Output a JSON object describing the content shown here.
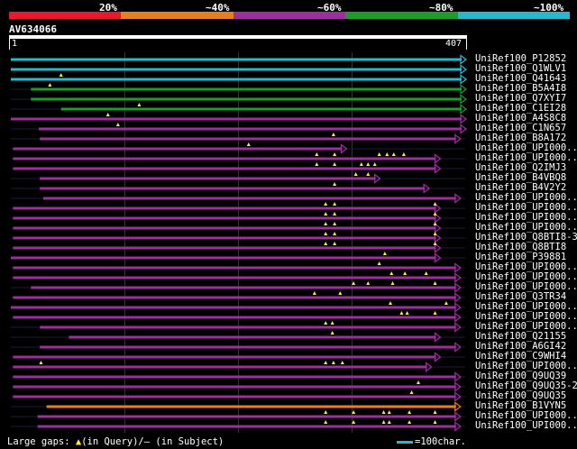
{
  "legend": {
    "labels": [
      "20%",
      "~40%",
      "~60%",
      "~80%",
      "~100%"
    ],
    "colors": [
      "#e8192c",
      "#e67e22",
      "#9b2f9b",
      "#1e9b2a",
      "#2ab7c9"
    ]
  },
  "query": {
    "id": "AV634066",
    "start": "1",
    "end": "407",
    "length": 407
  },
  "hits": [
    {
      "label": "UniRef100_P12852",
      "color": "#2ab7c9",
      "segs": [
        [
          0,
          407
        ]
      ],
      "arrow": true,
      "tris": []
    },
    {
      "label": "UniRef100_Q1WLV1",
      "color": "#2ab7c9",
      "segs": [
        [
          0,
          407
        ]
      ],
      "arrow": true,
      "tris": []
    },
    {
      "label": "UniRef100_Q41643",
      "color": "#2ab7c9",
      "segs": [
        [
          0,
          407
        ]
      ],
      "arrow": true,
      "tris": [
        45
      ]
    },
    {
      "label": "UniRef100_B5A4I8",
      "color": "#1e9b2a",
      "segs": [
        [
          18,
          407
        ]
      ],
      "arrow": true,
      "tris": [
        35
      ]
    },
    {
      "label": "UniRef100_Q7XYI7",
      "color": "#1e9b2a",
      "segs": [
        [
          18,
          407
        ]
      ],
      "arrow": true,
      "tris": []
    },
    {
      "label": "UniRef100_C1EI28",
      "color": "#1e9b2a",
      "segs": [
        [
          45,
          407
        ]
      ],
      "arrow": true,
      "tris": [
        115
      ]
    },
    {
      "label": "UniRef100_A4S8C8",
      "color": "#9b2f9b",
      "segs": [
        [
          0,
          407
        ]
      ],
      "arrow": true,
      "tris": [
        87
      ]
    },
    {
      "label": "UniRef100_C1N657",
      "color": "#9b2f9b",
      "segs": [
        [
          25,
          407
        ]
      ],
      "arrow": true,
      "tris": [
        96
      ]
    },
    {
      "label": "UniRef100_B8A172",
      "color": "#9b2f9b",
      "segs": [
        [
          26,
          402
        ]
      ],
      "arrow": true,
      "tris": [
        289
      ]
    },
    {
      "label": "UniRef100_UPI000..",
      "color": "#9b2f9b",
      "segs": [
        [
          2,
          300
        ]
      ],
      "arrow": true,
      "tris": [
        213
      ]
    },
    {
      "label": "UniRef100_UPI000..",
      "color": "#9b2f9b",
      "segs": [
        [
          2,
          384
        ]
      ],
      "arrow": true,
      "tris": [
        274,
        290,
        330,
        337,
        343,
        352
      ]
    },
    {
      "label": "UniRef100_Q2IMJ3",
      "color": "#9b2f9b",
      "segs": [
        [
          2,
          384
        ]
      ],
      "arrow": true,
      "tris": [
        274,
        290,
        314,
        320,
        326
      ]
    },
    {
      "label": "UniRef100_B4VBQ8",
      "color": "#9b2f9b",
      "segs": [
        [
          26,
          330
        ]
      ],
      "arrow": true,
      "tris": [
        309,
        320
      ]
    },
    {
      "label": "UniRef100_B4V2Y2",
      "color": "#9b2f9b",
      "segs": [
        [
          26,
          374
        ]
      ],
      "arrow": true,
      "tris": [
        290
      ]
    },
    {
      "label": "UniRef100_UPI000..",
      "color": "#9b2f9b",
      "segs": [
        [
          29,
          402
        ]
      ],
      "arrow": true,
      "tris": []
    },
    {
      "label": "UniRef100_UPI000..",
      "color": "#9b2f9b",
      "segs": [
        [
          2,
          384
        ]
      ],
      "arrow": true,
      "tris": [
        282,
        290,
        380
      ]
    },
    {
      "label": "UniRef100_UPI000..",
      "color": "#9b2f9b",
      "segs": [
        [
          2,
          384
        ]
      ],
      "arrow": true,
      "tris": [
        282,
        290,
        380
      ]
    },
    {
      "label": "UniRef100_UPI000..",
      "color": "#9b2f9b",
      "segs": [
        [
          2,
          384
        ]
      ],
      "arrow": true,
      "tris": [
        282,
        290,
        380
      ]
    },
    {
      "label": "UniRef100_Q8BTI8-3",
      "color": "#9b2f9b",
      "segs": [
        [
          2,
          384
        ]
      ],
      "arrow": true,
      "tris": [
        282,
        290,
        380
      ]
    },
    {
      "label": "UniRef100_Q8BTI8",
      "color": "#9b2f9b",
      "segs": [
        [
          2,
          384
        ]
      ],
      "arrow": true,
      "tris": [
        282,
        290,
        380
      ]
    },
    {
      "label": "UniRef100_P39881",
      "color": "#9b2f9b",
      "segs": [
        [
          0,
          384
        ]
      ],
      "arrow": true,
      "tris": [
        335
      ]
    },
    {
      "label": "UniRef100_UPI000..",
      "color": "#9b2f9b",
      "segs": [
        [
          2,
          402
        ]
      ],
      "arrow": true,
      "tris": [
        330
      ]
    },
    {
      "label": "UniRef100_UPI000..",
      "color": "#9b2f9b",
      "segs": [
        [
          2,
          402
        ]
      ],
      "arrow": true,
      "tris": [
        341,
        353,
        372
      ]
    },
    {
      "label": "UniRef100_UPI000..",
      "color": "#9b2f9b",
      "segs": [
        [
          18,
          402
        ]
      ],
      "arrow": true,
      "tris": [
        307,
        320,
        342,
        380
      ]
    },
    {
      "label": "UniRef100_Q3TR34",
      "color": "#9b2f9b",
      "segs": [
        [
          2,
          402
        ]
      ],
      "arrow": true,
      "tris": [
        272,
        295
      ]
    },
    {
      "label": "UniRef100_UPI000..",
      "color": "#9b2f9b",
      "segs": [
        [
          0,
          402
        ]
      ],
      "arrow": true,
      "tris": [
        340,
        390
      ]
    },
    {
      "label": "UniRef100_UPI000..",
      "color": "#9b2f9b",
      "segs": [
        [
          2,
          402
        ]
      ],
      "arrow": true,
      "tris": [
        350,
        355,
        380
      ]
    },
    {
      "label": "UniRef100_UPI000..",
      "color": "#9b2f9b",
      "segs": [
        [
          26,
          402
        ]
      ],
      "arrow": true,
      "tris": [
        282,
        288
      ]
    },
    {
      "label": "UniRef100_Q21155",
      "color": "#9b2f9b",
      "segs": [
        [
          52,
          384
        ]
      ],
      "arrow": true,
      "tris": [
        288
      ]
    },
    {
      "label": "UniRef100_A6GI42",
      "color": "#9b2f9b",
      "segs": [
        [
          26,
          402
        ]
      ],
      "arrow": true,
      "tris": []
    },
    {
      "label": "UniRef100_C9WHI4",
      "color": "#9b2f9b",
      "segs": [
        [
          2,
          384
        ]
      ],
      "arrow": true,
      "tris": []
    },
    {
      "label": "UniRef100_UPI000..",
      "color": "#9b2f9b",
      "segs": [
        [
          2,
          376
        ]
      ],
      "arrow": true,
      "tris": [
        27,
        282,
        289,
        297
      ]
    },
    {
      "label": "UniRef100_Q9UQ39",
      "color": "#9b2f9b",
      "segs": [
        [
          2,
          402
        ]
      ],
      "arrow": true,
      "tris": []
    },
    {
      "label": "UniRef100_Q9UQ35-2",
      "color": "#9b2f9b",
      "segs": [
        [
          2,
          402
        ]
      ],
      "arrow": true,
      "tris": [
        365
      ]
    },
    {
      "label": "UniRef100_Q9UQ35",
      "color": "#9b2f9b",
      "segs": [
        [
          2,
          402
        ]
      ],
      "arrow": true,
      "tris": [
        359
      ]
    },
    {
      "label": "UniRef100_B1VYN5",
      "color": "#e67e22",
      "segs": [
        [
          32,
          402
        ]
      ],
      "arrow": true,
      "tris": []
    },
    {
      "label": "UniRef100_UPI000..",
      "color": "#9b2f9b",
      "segs": [
        [
          24,
          402
        ]
      ],
      "arrow": true,
      "tris": [
        282,
        307,
        334,
        339,
        357,
        380
      ]
    },
    {
      "label": "UniRef100_UPI000..",
      "color": "#9b2f9b",
      "segs": [
        [
          24,
          402
        ]
      ],
      "arrow": true,
      "tris": [
        282,
        307,
        334,
        339,
        357,
        380
      ]
    }
  ],
  "footer": {
    "gaps_prefix": "Large gaps: ",
    "gaps_query": "(in Query)/",
    "gaps_subject": "— (in Subject)",
    "triangle_glyph": "▲",
    "scale_label": "=100char."
  }
}
